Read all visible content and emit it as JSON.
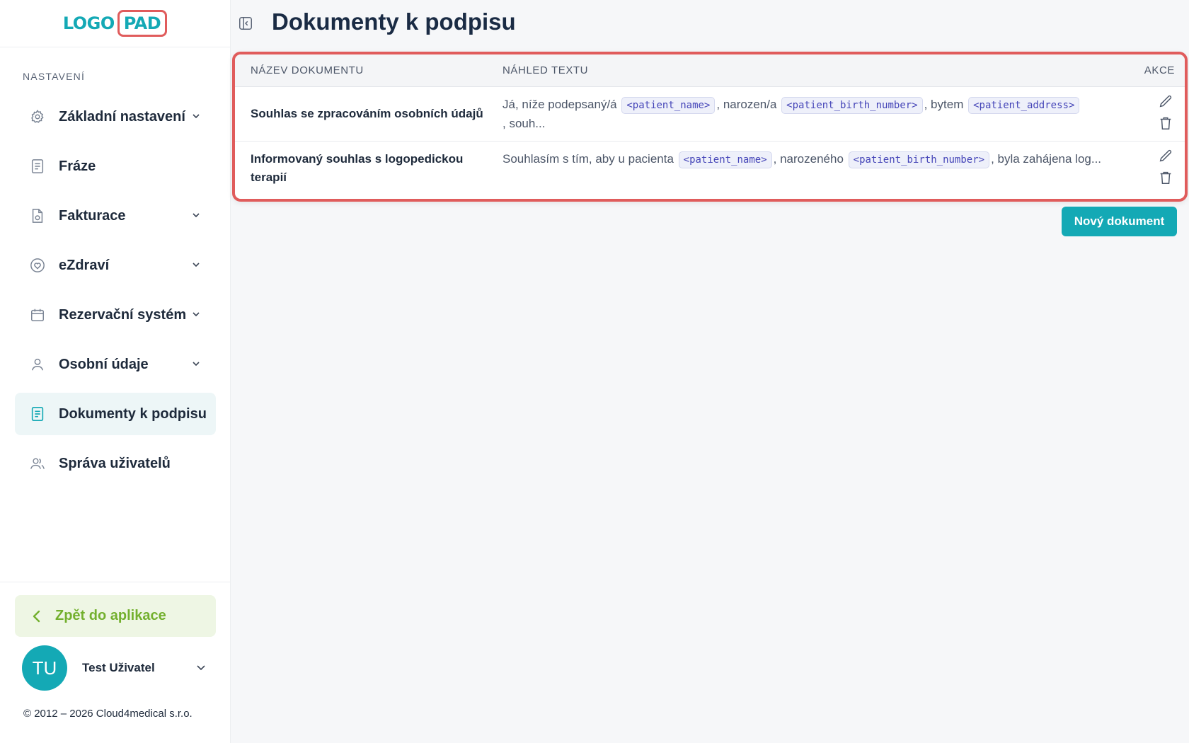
{
  "logo": {
    "part1": "LOGO",
    "part2": "PAD"
  },
  "sidebar": {
    "section_label": "NASTAVENÍ",
    "items": [
      {
        "label": "Základní nastavení",
        "icon": "gear-icon",
        "has_chevron": true,
        "active": false
      },
      {
        "label": "Fráze",
        "icon": "document-lines-icon",
        "has_chevron": false,
        "active": false
      },
      {
        "label": "Fakturace",
        "icon": "invoice-icon",
        "has_chevron": true,
        "active": false
      },
      {
        "label": "eZdraví",
        "icon": "heart-circle-icon",
        "has_chevron": true,
        "active": false
      },
      {
        "label": "Rezervační systém",
        "icon": "calendar-icon",
        "has_chevron": true,
        "active": false
      },
      {
        "label": "Osobní údaje",
        "icon": "user-icon",
        "has_chevron": true,
        "active": false
      },
      {
        "label": "Dokumenty k podpisu",
        "icon": "document-lines-icon",
        "has_chevron": false,
        "active": true
      },
      {
        "label": "Správa uživatelů",
        "icon": "users-icon",
        "has_chevron": false,
        "active": false
      }
    ],
    "back_label": "Zpět do aplikace",
    "user": {
      "initials": "TU",
      "name": "Test Uživatel"
    },
    "copyright": "© 2012 – 2026 Cloud4medical s.r.o."
  },
  "main": {
    "title": "Dokumenty k podpisu",
    "table": {
      "headers": {
        "name": "NÁZEV DOKUMENTU",
        "preview": "NÁHLED TEXTU",
        "actions": "AKCE"
      },
      "rows": [
        {
          "name": "Souhlas se zpracováním osobních údajů",
          "preview": {
            "t1": "Já, níže podepsaný/á",
            "tag1": "<patient_name>",
            "t2": ", narozen/a",
            "tag2": "<patient_birth_number>",
            "t3": ", bytem",
            "tag3": "<patient_address>",
            "t4": ", souh..."
          }
        },
        {
          "name": "Informovaný souhlas s logopedickou terapií",
          "preview": {
            "t1": "Souhlasím s tím, aby u pacienta",
            "tag1": "<patient_name>",
            "t2": ", narozeného",
            "tag2": "<patient_birth_number>",
            "t3": ", byla zahájena log..."
          }
        }
      ]
    },
    "new_button": "Nový dokument"
  },
  "colors": {
    "brand": "#14a9b5",
    "highlight_border": "#e05c5c",
    "back_green": "#73b02e"
  }
}
